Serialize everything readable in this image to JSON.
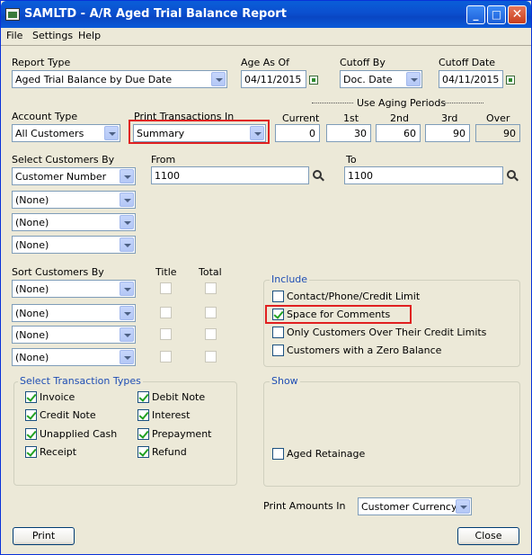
{
  "window": {
    "title": "SAMLTD - A/R Aged Trial Balance Report",
    "controls": {
      "minimize": "_",
      "maximize": "□",
      "close": "✕"
    }
  },
  "menu": [
    "File",
    "Settings",
    "Help"
  ],
  "report_type": {
    "label": "Report Type",
    "value": "Aged Trial Balance by Due Date"
  },
  "age_as_of": {
    "label": "Age As Of",
    "value": "04/11/2015"
  },
  "cutoff_by": {
    "label": "Cutoff By",
    "value": "Doc. Date"
  },
  "cutoff_date": {
    "label": "Cutoff Date",
    "value": "04/11/2015"
  },
  "account_type": {
    "label": "Account Type",
    "value": "All Customers"
  },
  "print_transactions_in": {
    "label": "Print Transactions In",
    "value": "Summary"
  },
  "aging": {
    "title": "Use Aging Periods",
    "headers": [
      "Current",
      "1st",
      "2nd",
      "3rd",
      "Over"
    ],
    "values": [
      "0",
      "30",
      "60",
      "90",
      "90"
    ]
  },
  "select_customers": {
    "label": "Select Customers By",
    "fields": [
      "Customer Number",
      "(None)",
      "(None)",
      "(None)"
    ],
    "from_label": "From",
    "from_value": "1100",
    "to_label": "To",
    "to_value": "1100"
  },
  "sort_customers": {
    "label": "Sort Customers By",
    "title_header": "Title",
    "total_header": "Total",
    "fields": [
      "(None)",
      "(None)",
      "(None)",
      "(None)"
    ]
  },
  "include": {
    "title": "Include",
    "items": [
      {
        "label": "Contact/Phone/Credit Limit",
        "checked": false
      },
      {
        "label": "Space for Comments",
        "checked": true
      },
      {
        "label": "Only Customers Over Their Credit Limits",
        "checked": false
      },
      {
        "label": "Customers with a Zero Balance",
        "checked": false
      }
    ]
  },
  "transaction_types": {
    "title": "Select Transaction Types",
    "items": [
      {
        "label": "Invoice",
        "checked": true
      },
      {
        "label": "Debit Note",
        "checked": true
      },
      {
        "label": "Credit Note",
        "checked": true
      },
      {
        "label": "Interest",
        "checked": true
      },
      {
        "label": "Unapplied Cash",
        "checked": true
      },
      {
        "label": "Prepayment",
        "checked": true
      },
      {
        "label": "Receipt",
        "checked": true
      },
      {
        "label": "Refund",
        "checked": true
      }
    ]
  },
  "show": {
    "title": "Show",
    "aged_retainage_label": "Aged Retainage",
    "aged_retainage_checked": false
  },
  "print_amounts_in": {
    "label": "Print Amounts In",
    "value": "Customer Currency"
  },
  "buttons": {
    "print": "Print",
    "close": "Close"
  },
  "colors": {
    "titlebar": "#0a5ed8",
    "group_title": "#1f4eb4",
    "highlight": "#e02020",
    "check": "#21a121"
  }
}
